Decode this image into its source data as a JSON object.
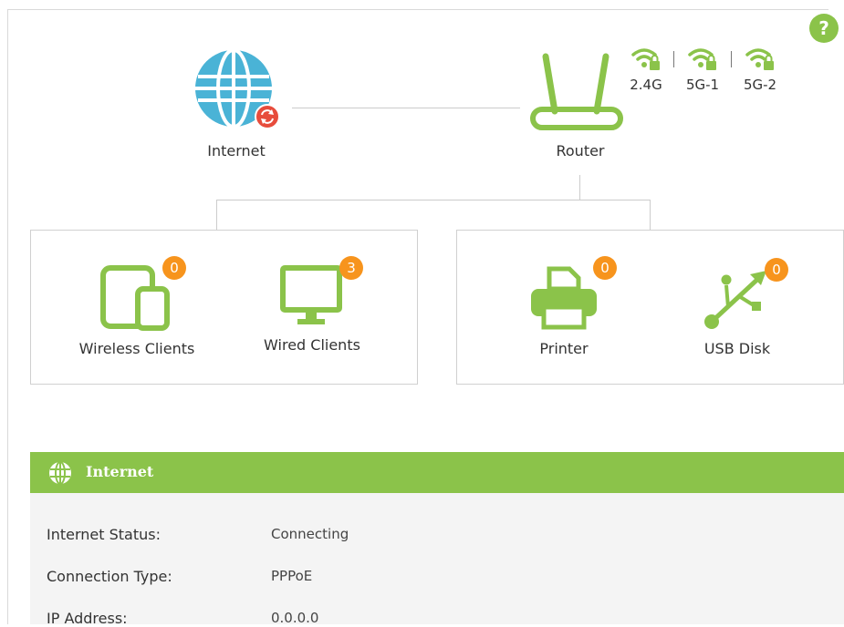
{
  "help_label": "?",
  "topology": {
    "internet_label": "Internet",
    "router_label": "Router",
    "bands": [
      "2.4G",
      "5G-1",
      "5G-2"
    ]
  },
  "devices": {
    "wireless_clients": {
      "label": "Wireless Clients",
      "count": "0"
    },
    "wired_clients": {
      "label": "Wired Clients",
      "count": "3"
    },
    "printer": {
      "label": "Printer",
      "count": "0"
    },
    "usb_disk": {
      "label": "USB Disk",
      "count": "0"
    }
  },
  "internet_section": {
    "title": "Internet",
    "rows": [
      {
        "label": "Internet Status:",
        "value": "Connecting"
      },
      {
        "label": "Connection Type:",
        "value": "PPPoE"
      },
      {
        "label": "IP Address:",
        "value": "0.0.0.0"
      }
    ]
  },
  "colors": {
    "accent_green": "#8bc34a",
    "globe_blue": "#4ab3d6",
    "badge_orange": "#f7941d",
    "alert_red": "#e74c3c"
  },
  "icons": [
    "globe-icon",
    "sync-icon",
    "router-icon",
    "wifi-lock-icon",
    "tablet-phone-icon",
    "monitor-icon",
    "printer-icon",
    "usb-icon",
    "help-icon"
  ]
}
